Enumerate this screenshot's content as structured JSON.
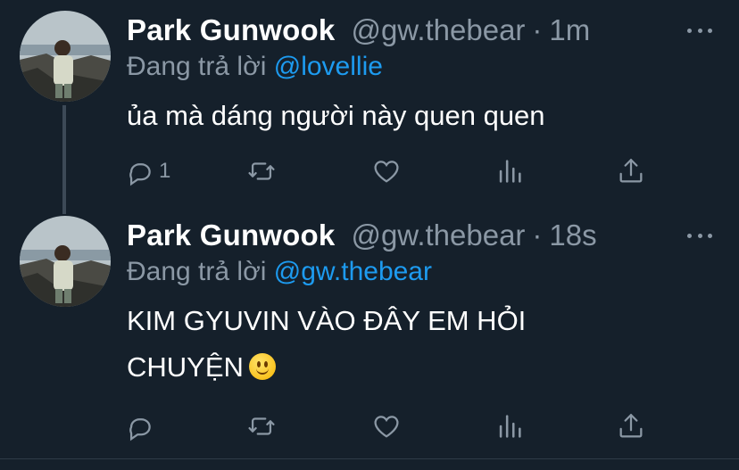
{
  "tweets": [
    {
      "display_name": "Park Gunwook",
      "handle": "@gw.thebear",
      "separator": "·",
      "time": "1m",
      "reply_prefix": "Đang trả lời",
      "reply_mention": "@lovellie",
      "text": "ủa mà dáng người này quen quen",
      "reply_count": "1"
    },
    {
      "display_name": "Park Gunwook",
      "handle": "@gw.thebear",
      "separator": "·",
      "time": "18s",
      "reply_prefix": "Đang trả lời",
      "reply_mention": "@gw.thebear",
      "text_line1": "KIM GYUVIN VÀO ĐÂY EM HỎI",
      "text_line2": "CHUYỆN",
      "emoji": "slightly-smiling-face",
      "reply_count": ""
    }
  ],
  "colors": {
    "background": "#15202b",
    "primary_text": "#ffffff",
    "secondary_text": "#8b98a5",
    "mention": "#1d9bf0",
    "thread_line": "#3d4a57"
  }
}
